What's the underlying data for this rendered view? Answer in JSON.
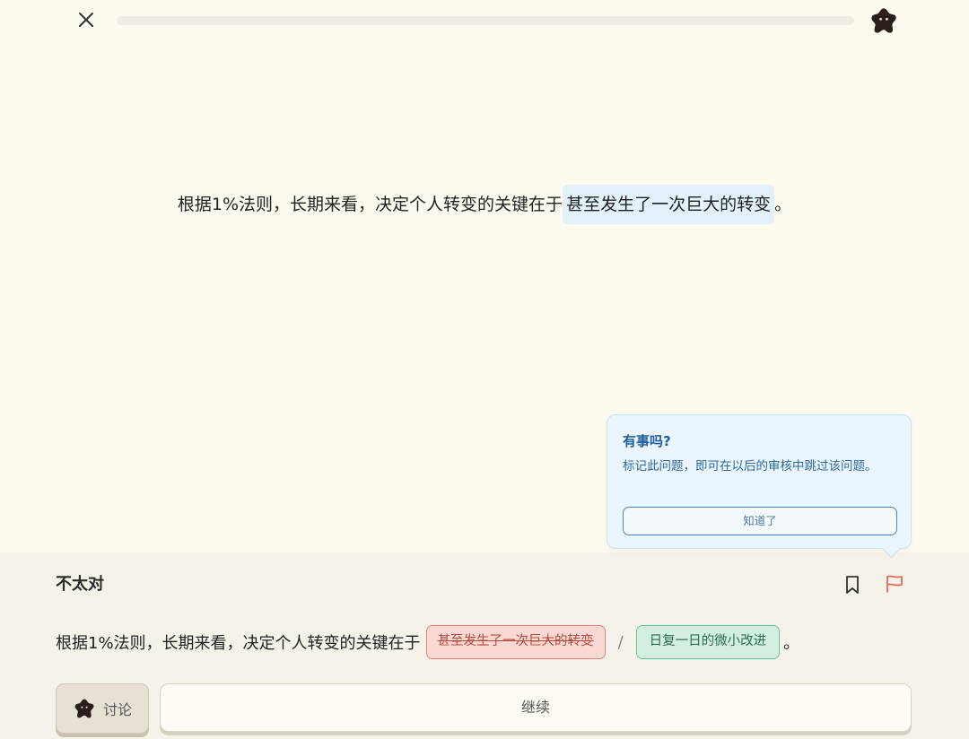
{
  "topbar": {
    "close_icon": "close-icon",
    "progress_fraction": 0,
    "mascot_icon": "mascot-icon"
  },
  "question": {
    "prefix": "根据1%法则，长期来看，决定个人转变的关键在于",
    "highlight": "甚至发生了一次巨大的转变",
    "suffix": "。"
  },
  "tooltip": {
    "title": "有事吗?",
    "body": "标记此问题，即可在以后的审核中跳过该问题。",
    "button": "知道了"
  },
  "feedback": {
    "title": "不太对",
    "bookmark_icon": "bookmark-icon",
    "flag_icon": "flag-icon",
    "answer_prefix": "根据1%法则，长期来看，决定个人转变的关键在于",
    "wrong_answer": "甚至发生了一次巨大的转变",
    "separator": "/",
    "correct_answer": "日复一日的微小改进",
    "answer_suffix": "。",
    "discuss_label": "讨论",
    "continue_label": "继续"
  },
  "colors": {
    "background": "#fdfaf0",
    "panel": "#f5f2e9",
    "wrong": "#e8837a",
    "correct": "#6fbf9c",
    "tooltip_accent": "#1f5f9b",
    "flag": "#e36b5a"
  }
}
